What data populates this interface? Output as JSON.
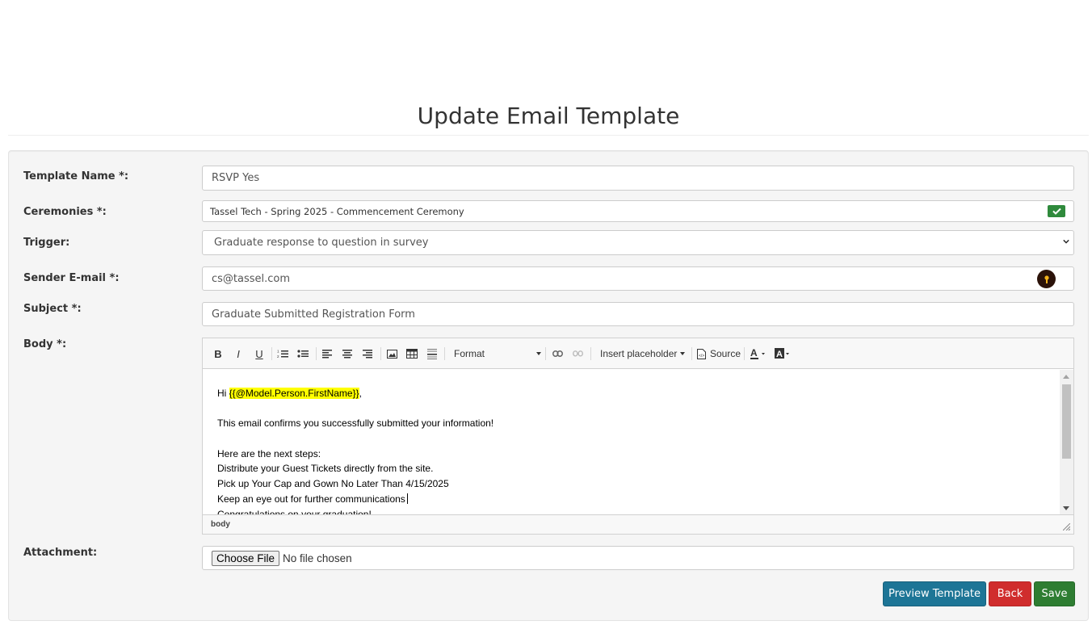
{
  "page": {
    "title": "Update Email Template"
  },
  "form": {
    "template_name": {
      "label": "Template Name *:",
      "value": "RSVP Yes"
    },
    "ceremonies": {
      "label": "Ceremonies *:",
      "value": "Tassel Tech - Spring 2025 - Commencement Ceremony"
    },
    "trigger": {
      "label": "Trigger:",
      "value": "Graduate response to question in survey"
    },
    "sender": {
      "label": "Sender E-mail *:",
      "value": "cs@tassel.com"
    },
    "subject": {
      "label": "Subject *:",
      "value": "Graduate Submitted Registration Form"
    },
    "body": {
      "label": "Body *:"
    },
    "attachment": {
      "label": "Attachment:",
      "button": "Choose File",
      "status": "No file chosen"
    }
  },
  "editor": {
    "toolbar": {
      "bold": "B",
      "italic": "I",
      "underline": "U",
      "format": "Format",
      "insert_placeholder": "Insert placeholder",
      "source": "Source"
    },
    "content": {
      "greeting_prefix": "Hi ",
      "placeholder": "{{@Model.Person.FirstName}}",
      "greeting_suffix": ",",
      "line1": "This email confirms you successfully submitted your information!",
      "line2": "Here are the next steps:",
      "line3": "Distribute your Guest Tickets directly from the site.",
      "line4": "Pick up Your Cap and Gown No Later Than 4/15/2025",
      "line5": "Keep an eye out for further communications",
      "line6": "Congratulations on your graduation!"
    },
    "status_path": "body"
  },
  "buttons": {
    "preview": "Preview Template",
    "back": "Back",
    "save": "Save"
  },
  "colors": {
    "preview": "#1d7596",
    "back": "#d02d2d",
    "save": "#2e7d32",
    "highlight": "#ffff00"
  },
  "icons": [
    "check-icon",
    "chevron-down-icon",
    "key-icon",
    "bold-icon",
    "italic-icon",
    "underline-icon",
    "numbered-list-icon",
    "bulleted-list-icon",
    "align-left-icon",
    "align-center-icon",
    "align-right-icon",
    "image-icon",
    "table-icon",
    "horizontal-line-icon",
    "link-icon",
    "unlink-icon",
    "source-icon",
    "text-color-icon",
    "background-color-icon"
  ]
}
